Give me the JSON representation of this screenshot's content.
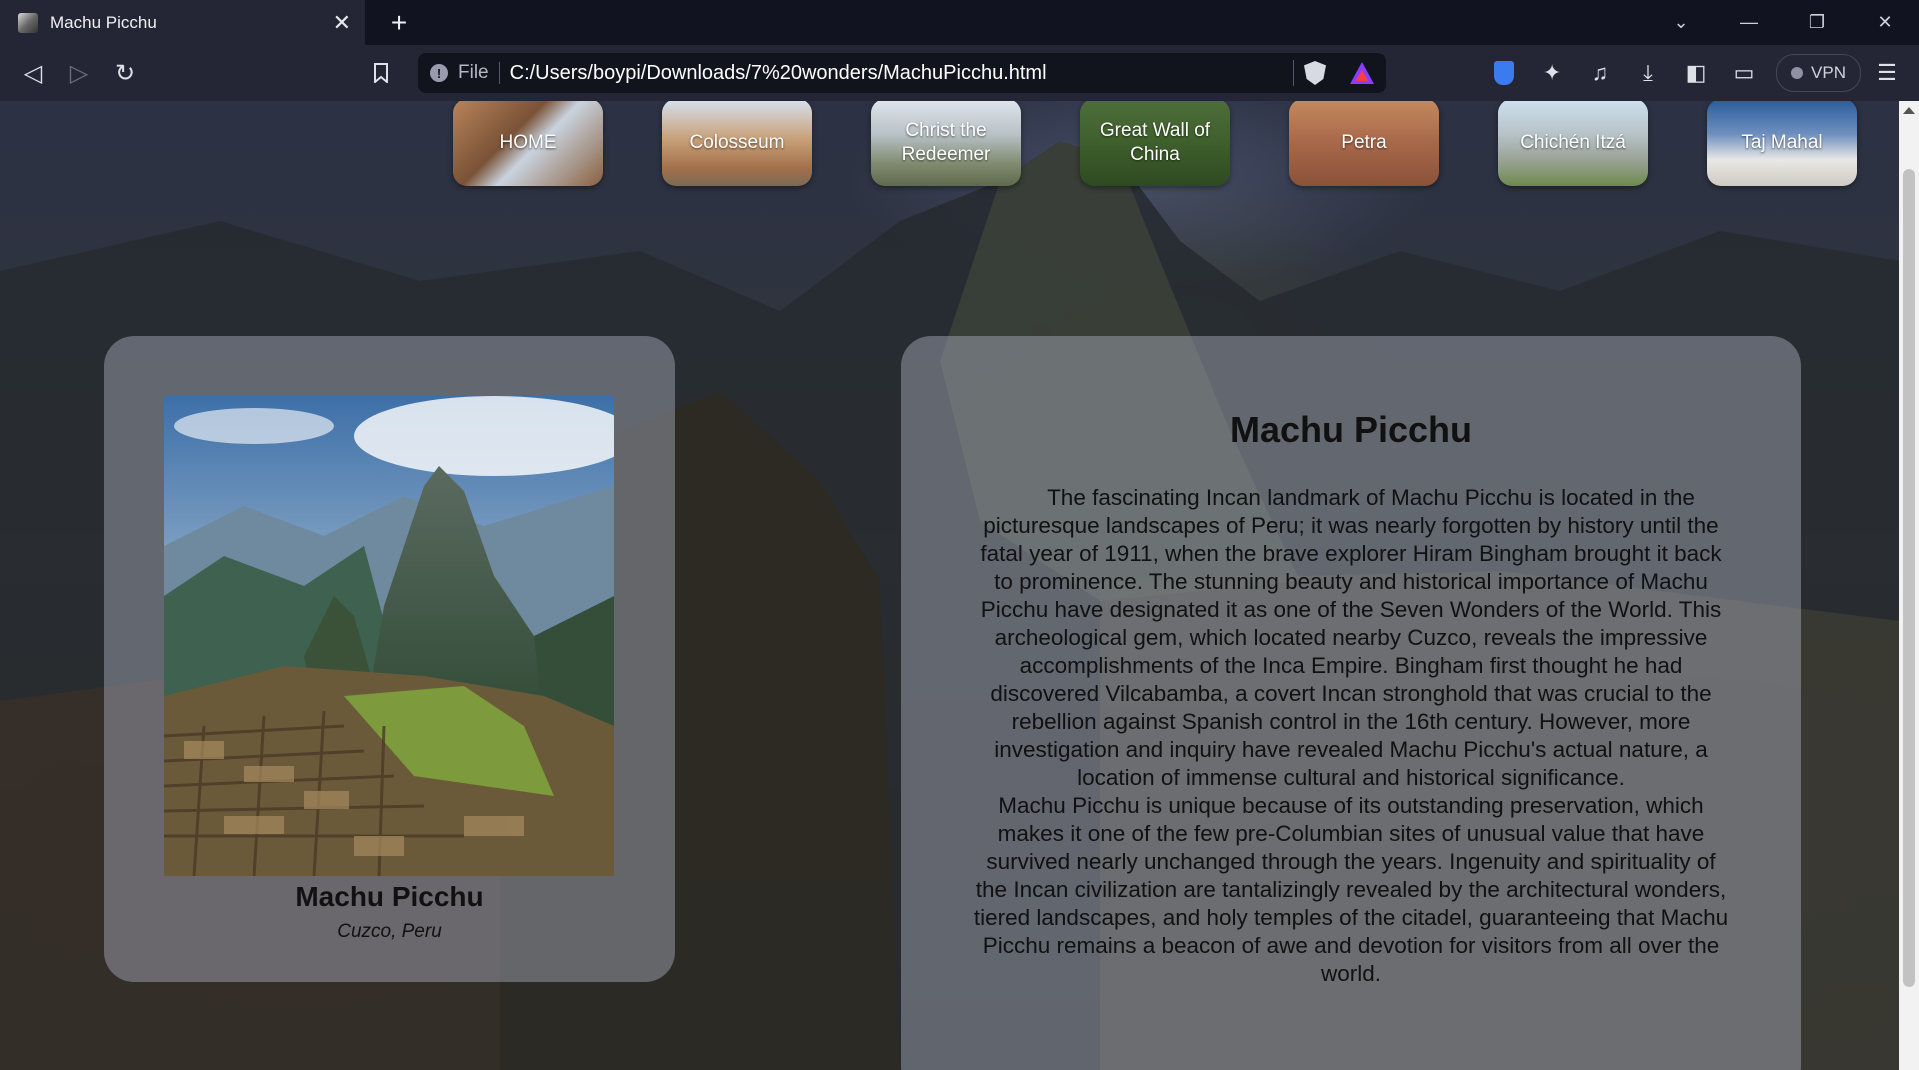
{
  "browser": {
    "tab_title": "Machu Picchu",
    "scheme_label": "File",
    "url": "C:/Users/boypi/Downloads/7%20wonders/MachuPicchu.html",
    "vpn_label": "VPN"
  },
  "nav": {
    "items": [
      {
        "label": "HOME"
      },
      {
        "label": "Colosseum"
      },
      {
        "label": "Christ the Redeemer"
      },
      {
        "label": "Great Wall of China"
      },
      {
        "label": "Petra"
      },
      {
        "label": "Chichén Itzá"
      },
      {
        "label": "Taj Mahal"
      }
    ]
  },
  "wonder": {
    "photo_title": "Machu Picchu",
    "photo_location": "Cuzco, Peru",
    "heading": "Machu Picchu",
    "paragraphs": [
      "The fascinating Incan landmark of Machu Picchu is located in the picturesque landscapes of Peru; it was nearly forgotten by history until the fatal year of 1911, when the brave explorer Hiram Bingham brought it back to prominence. The stunning beauty and historical importance of Machu Picchu have designated it as one of the Seven Wonders of the World. This archeological gem, which located nearby Cuzco, reveals the impressive accomplishments of the Inca Empire. Bingham first thought he had discovered Vilcabamba, a covert Incan stronghold that was crucial to the rebellion against Spanish control in the 16th century. However, more investigation and inquiry have revealed Machu Picchu's actual nature, a location of immense cultural and historical significance.",
      "Machu Picchu is unique because of its outstanding preservation, which makes it one of the few pre-Columbian sites of unusual value that have survived nearly unchanged through the years. Ingenuity and spirituality of the Incan civilization are tantalizingly revealed by the architectural wonders, tiered landscapes, and holy temples of the citadel, guaranteeing that Machu Picchu remains a beacon of awe and devotion for visitors from all over the world."
    ]
  },
  "icons": [
    "back-icon",
    "forward-icon",
    "reload-icon",
    "bookmark-icon",
    "info-icon",
    "brave-shields-icon",
    "brave-rewards-icon",
    "bitwarden-icon",
    "extensions-icon",
    "media-icon",
    "download-icon",
    "sidebar-icon",
    "wallet-icon",
    "menu-icon",
    "tab-list-icon",
    "minimize-icon",
    "restore-icon",
    "close-window-icon"
  ]
}
